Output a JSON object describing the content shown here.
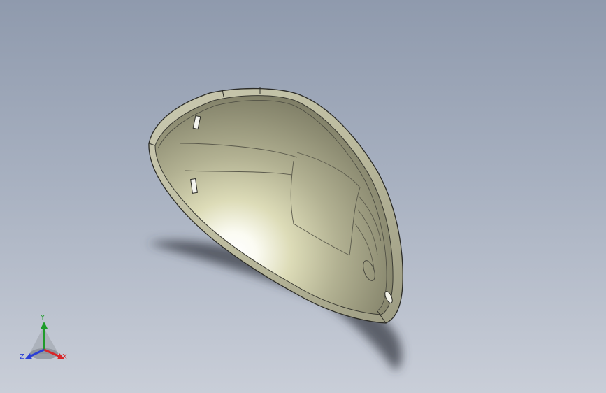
{
  "viewport": {
    "background_top": "#8f9aad",
    "background_bottom": "#c9ced8",
    "part": {
      "color": "#d9d8c8",
      "edge_color": "#2b2b26",
      "highlight": "#ffffff"
    }
  },
  "triad": {
    "x_label": "X",
    "y_label": "Y",
    "z_label": "Z",
    "x_color": "#d8262a",
    "y_color": "#1e9c2a",
    "z_color": "#2a3ed6"
  }
}
